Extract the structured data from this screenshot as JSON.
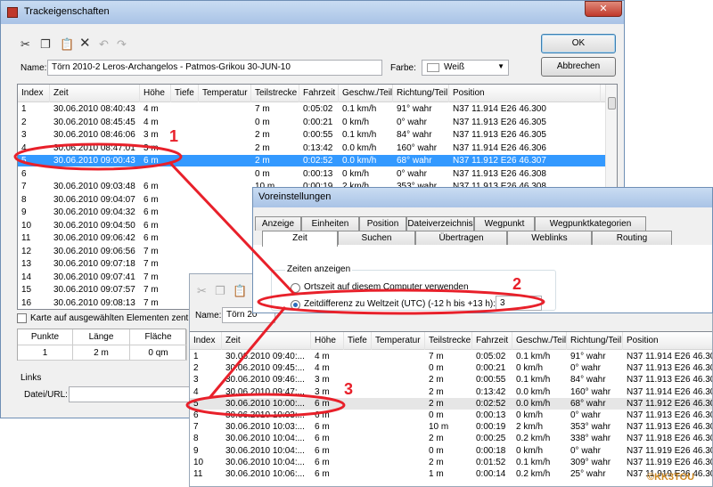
{
  "main_dialog": {
    "title": "Trackeigenschaften",
    "name_label": "Name:",
    "name_value": "Törn 2010-2  Leros-Archangelos - Patmos-Grikou 30-JUN-10",
    "color_label": "Farbe:",
    "color_value": "Weiß",
    "ok_label": "OK",
    "cancel_label": "Abbrechen",
    "columns": [
      "Index",
      "Zeit",
      "Höhe",
      "Tiefe",
      "Temperatur",
      "Teilstrecke",
      "Fahrzeit",
      "Geschw./Teil",
      "Richtung/Teil",
      "Position"
    ],
    "rows": [
      [
        "1",
        "30.06.2010 08:40:43",
        "4 m",
        "",
        "",
        "7 m",
        "0:05:02",
        "0.1 km/h",
        "91° wahr",
        "N37 11.914 E26 46.300"
      ],
      [
        "2",
        "30.06.2010 08:45:45",
        "4 m",
        "",
        "",
        "0 m",
        "0:00:21",
        "0 km/h",
        "0° wahr",
        "N37 11.913 E26 46.305"
      ],
      [
        "3",
        "30.06.2010 08:46:06",
        "3 m",
        "",
        "",
        "2 m",
        "0:00:55",
        "0.1 km/h",
        "84° wahr",
        "N37 11.913 E26 46.305"
      ],
      [
        "4",
        "30.06.2010 08:47:01",
        "3 m",
        "",
        "",
        "2 m",
        "0:13:42",
        "0.0 km/h",
        "160° wahr",
        "N37 11.914 E26 46.306"
      ],
      [
        "5",
        "30.06.2010 09:00:43",
        "6 m",
        "",
        "",
        "2 m",
        "0:02:52",
        "0.0 km/h",
        "68° wahr",
        "N37 11.912 E26 46.307"
      ],
      [
        "6",
        "",
        "",
        "",
        "",
        "0 m",
        "0:00:13",
        "0 km/h",
        "0° wahr",
        "N37 11.913 E26 46.308"
      ],
      [
        "7",
        "30.06.2010 09:03:48",
        "6 m",
        "",
        "",
        "10 m",
        "0:00:19",
        "2 km/h",
        "353° wahr",
        "N37 11.913 E26 46.308"
      ],
      [
        "8",
        "30.06.2010 09:04:07",
        "6 m",
        "",
        "",
        "",
        "",
        "",
        "",
        ""
      ],
      [
        "9",
        "30.06.2010 09:04:32",
        "6 m",
        "",
        "",
        "",
        "",
        "",
        "",
        ""
      ],
      [
        "10",
        "30.06.2010 09:04:50",
        "6 m",
        "",
        "",
        "",
        "",
        "",
        "",
        ""
      ],
      [
        "11",
        "30.06.2010 09:06:42",
        "6 m",
        "",
        "",
        "",
        "",
        "",
        "",
        ""
      ],
      [
        "12",
        "30.06.2010 09:06:56",
        "7 m",
        "",
        "",
        "",
        "",
        "",
        "",
        ""
      ],
      [
        "13",
        "30.06.2010 09:07:18",
        "7 m",
        "",
        "",
        "",
        "",
        "",
        "",
        ""
      ],
      [
        "14",
        "30.06.2010 09:07:41",
        "7 m",
        "",
        "",
        "",
        "",
        "",
        "",
        ""
      ],
      [
        "15",
        "30.06.2010 09:07:57",
        "7 m",
        "",
        "",
        "",
        "",
        "",
        "",
        ""
      ],
      [
        "16",
        "30.06.2010 09:08:13",
        "7 m",
        "",
        "",
        "",
        "",
        "",
        "",
        ""
      ]
    ],
    "map_checkbox_label": "Karte auf ausgewählten Elementen zentrie",
    "stats_headers": [
      "Punkte",
      "Länge",
      "Fläche"
    ],
    "stats_values": [
      "1",
      "2 m",
      "0 qm"
    ],
    "links_label": "Links",
    "url_label": "Datei/URL:"
  },
  "prefs_dialog": {
    "title": "Voreinstellungen",
    "tabs_top": [
      "Anzeige",
      "Einheiten",
      "Position",
      "Dateiverzeichnis",
      "Wegpunkt",
      "Wegpunktkategorien"
    ],
    "tabs_bottom": [
      "Zeit",
      "Suchen",
      "Übertragen",
      "Weblinks",
      "Routing"
    ],
    "group_label": "Zeiten anzeigen",
    "radio1_label": "Ortszeit auf diesem Computer verwenden",
    "radio2_label": "Zeitdifferenz zu Weltzeit (UTC) (-12 h bis +13 h):",
    "offset_value": "3"
  },
  "second_dialog": {
    "name_label": "Name:",
    "name_value": "Törn 20",
    "columns": [
      "Index",
      "Zeit",
      "Höhe",
      "Tiefe",
      "Temperatur",
      "Teilstrecke",
      "Fahrzeit",
      "Geschw./Teil",
      "Richtung/Teil",
      "Position"
    ],
    "rows": [
      [
        "1",
        "30.06.2010 09:40:...",
        "4 m",
        "",
        "",
        "7 m",
        "0:05:02",
        "0.1 km/h",
        "91° wahr",
        "N37 11.914 E26 46.300"
      ],
      [
        "2",
        "30.06.2010 09:45:...",
        "4 m",
        "",
        "",
        "0 m",
        "0:00:21",
        "0 km/h",
        "0° wahr",
        "N37 11.913 E26 46.305"
      ],
      [
        "3",
        "30.06.2010 09:46:...",
        "3 m",
        "",
        "",
        "2 m",
        "0:00:55",
        "0.1 km/h",
        "84° wahr",
        "N37 11.913 E26 46.305"
      ],
      [
        "4",
        "30.06.2010 09:47:...",
        "3 m",
        "",
        "",
        "2 m",
        "0:13:42",
        "0.0 km/h",
        "160° wahr",
        "N37 11.914 E26 46.306"
      ],
      [
        "5",
        "30.06.2010 10:00:...",
        "6 m",
        "",
        "",
        "2 m",
        "0:02:52",
        "0.0 km/h",
        "68° wahr",
        "N37 11.912 E26 46.307"
      ],
      [
        "6",
        "30.06.2010 10:03:...",
        "6 m",
        "",
        "",
        "0 m",
        "0:00:13",
        "0 km/h",
        "0° wahr",
        "N37 11.913 E26 46.308"
      ],
      [
        "7",
        "30.06.2010 10:03:...",
        "6 m",
        "",
        "",
        "10 m",
        "0:00:19",
        "2 km/h",
        "353° wahr",
        "N37 11.913 E26 46.308"
      ],
      [
        "8",
        "30.06.2010 10:04:...",
        "6 m",
        "",
        "",
        "2 m",
        "0:00:25",
        "0.2 km/h",
        "338° wahr",
        "N37 11.918 E26 46.307"
      ],
      [
        "9",
        "30.06.2010 10:04:...",
        "6 m",
        "",
        "",
        "0 m",
        "0:00:18",
        "0 km/h",
        "0° wahr",
        "N37 11.919 E26 46.306"
      ],
      [
        "10",
        "30.06.2010 10:04:...",
        "6 m",
        "",
        "",
        "2 m",
        "0:01:52",
        "0.1 km/h",
        "309° wahr",
        "N37 11.919 E26 46.306"
      ],
      [
        "11",
        "30.06.2010 10:06:...",
        "6 m",
        "",
        "",
        "1 m",
        "0:00:14",
        "0.2 km/h",
        "25° wahr",
        "N37 11.919 E26 46.306"
      ]
    ]
  },
  "annotations": {
    "badge1": "1",
    "badge2": "2",
    "badge3": "3",
    "watermark": "©KK3TOU"
  },
  "colors": {
    "selection": "#3399ff",
    "annotation_red": "#e8202a"
  }
}
